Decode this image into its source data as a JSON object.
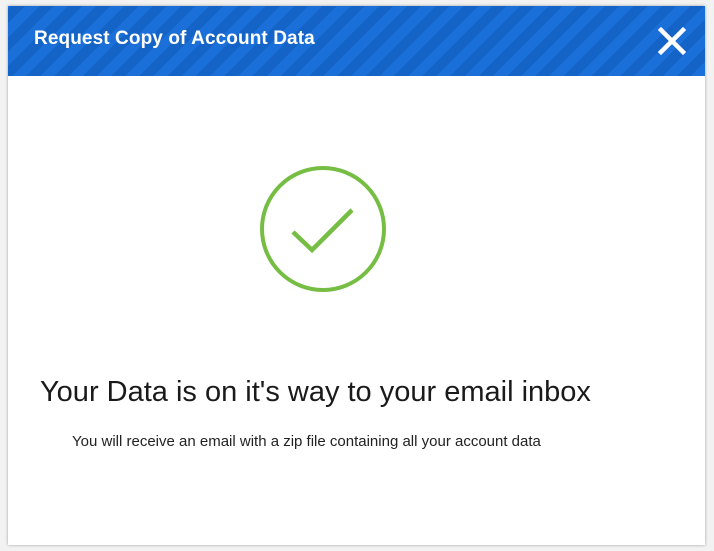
{
  "dialog": {
    "title": "Request Copy of Account Data",
    "close_icon": "close-icon",
    "status_icon": "checkmark-circle-icon",
    "headline": "Your Data is on it's way to your email inbox",
    "message": "You will receive an email with a zip file containing all your account data"
  },
  "colors": {
    "header_primary": "#1a6fd9",
    "header_stripe": "#1464c7",
    "success_green": "#76bd43",
    "text_dark": "#1a1a1a"
  }
}
